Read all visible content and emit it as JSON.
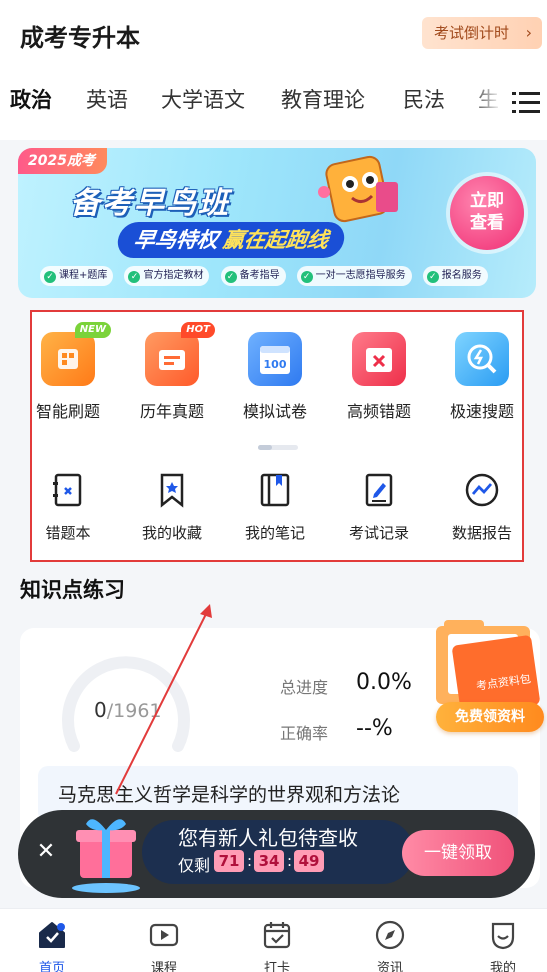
{
  "header": {
    "title": "成考专升本",
    "countdown_label": "考试倒计时",
    "countdown_chevron": "›"
  },
  "subjects": {
    "tabs": [
      "政治",
      "英语",
      "大学语文",
      "教育理论",
      "民法",
      "生"
    ],
    "active_index": 0,
    "menu_icon": "menu-icon"
  },
  "banner": {
    "year_tag": "2025成考",
    "title": "备考早鸟班",
    "subtitle_a": "早鸟特权",
    "subtitle_b": "赢在起跑线",
    "cta_line1": "立即",
    "cta_line2": "查看",
    "tags": [
      "课程+题库",
      "官方指定教材",
      "备考指导",
      "一对一志愿指导服务",
      "报名服务"
    ]
  },
  "tools": {
    "primary": [
      {
        "label": "智能刷题",
        "icon": "smart-practice-icon",
        "badge": "NEW",
        "color": "#ff8a1f"
      },
      {
        "label": "历年真题",
        "icon": "past-papers-icon",
        "badge": "HOT",
        "color": "#ff6b35"
      },
      {
        "label": "模拟试卷",
        "icon": "mock-exam-icon",
        "badge": "",
        "color": "#3c8ef5"
      },
      {
        "label": "高频错题",
        "icon": "frequent-mistakes-icon",
        "badge": "",
        "color": "#f0445a"
      },
      {
        "label": "极速搜题",
        "icon": "quick-search-icon",
        "badge": "",
        "color": "#29a7f5"
      }
    ],
    "mock_exam_number": "100",
    "secondary": [
      {
        "label": "错题本",
        "icon": "mistake-book-icon"
      },
      {
        "label": "我的收藏",
        "icon": "bookmark-icon"
      },
      {
        "label": "我的笔记",
        "icon": "notebook-icon"
      },
      {
        "label": "考试记录",
        "icon": "exam-record-icon"
      },
      {
        "label": "数据报告",
        "icon": "data-report-icon"
      }
    ]
  },
  "practice": {
    "section_title": "知识点练习",
    "done": "0",
    "total": "/1961",
    "progress_label": "总进度",
    "progress_value": "0.0%",
    "progress_fraction": 0,
    "accuracy_label": "正确率",
    "accuracy_value": "--%",
    "topic": "马克思主义哲学是科学的世界观和方法论",
    "promo_button": "免费领资料",
    "promo_folder_text": "考点资料包"
  },
  "popup": {
    "title": "您有新人礼包待查收",
    "remain_label": "仅剩",
    "hours": "71",
    "minutes": "34",
    "seconds": "49",
    "separator": ":",
    "cta": "一键领取",
    "close": "✕"
  },
  "tabbar": [
    {
      "label": "首页",
      "icon": "home-icon",
      "active": true
    },
    {
      "label": "课程",
      "icon": "course-icon",
      "active": false
    },
    {
      "label": "打卡",
      "icon": "check-in-icon",
      "active": false
    },
    {
      "label": "资讯",
      "icon": "news-compass-icon",
      "active": false
    },
    {
      "label": "我的",
      "icon": "profile-icon",
      "active": false
    }
  ],
  "colors": {
    "accent_blue": "#1f58e8",
    "annotation_red": "#e23b3b",
    "popup_pink": "#f0527a"
  }
}
